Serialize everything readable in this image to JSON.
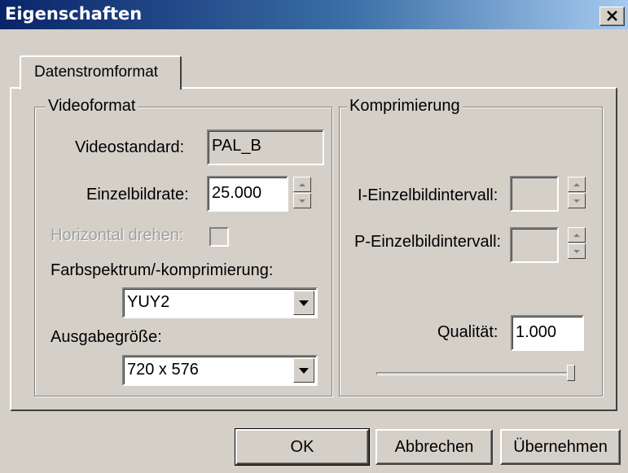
{
  "window": {
    "title": "Eigenschaften",
    "close_icon": "close-x-icon"
  },
  "tabs": [
    {
      "label": "Datenstromformat",
      "active": true
    }
  ],
  "videoformat": {
    "group_title": "Videoformat",
    "videostandard_label": "Videostandard:",
    "videostandard_value": "PAL_B",
    "framerate_label": "Einzelbildrate:",
    "framerate_value": "25.000",
    "flip_label": "Horizontal drehen:",
    "flip_checked": false,
    "colorspace_label": "Farbspektrum/-komprimierung:",
    "colorspace_value": "YUY2",
    "outputsize_label": "Ausgabegröße:",
    "outputsize_value": "720 x 576"
  },
  "compression": {
    "group_title": "Komprimierung",
    "iframe_label": "I-Einzelbildintervall:",
    "iframe_value": "",
    "pframe_label": "P-Einzelbildintervall:",
    "pframe_value": "",
    "quality_label": "Qualität:",
    "quality_value": "1.000",
    "quality_slider_level": 1.0
  },
  "buttons": {
    "ok": "OK",
    "cancel": "Abbrechen",
    "apply": "Übernehmen"
  },
  "colors": {
    "titlebar_start": "#0a246a",
    "titlebar_end": "#a6caf0",
    "face": "#d4d0c8"
  }
}
